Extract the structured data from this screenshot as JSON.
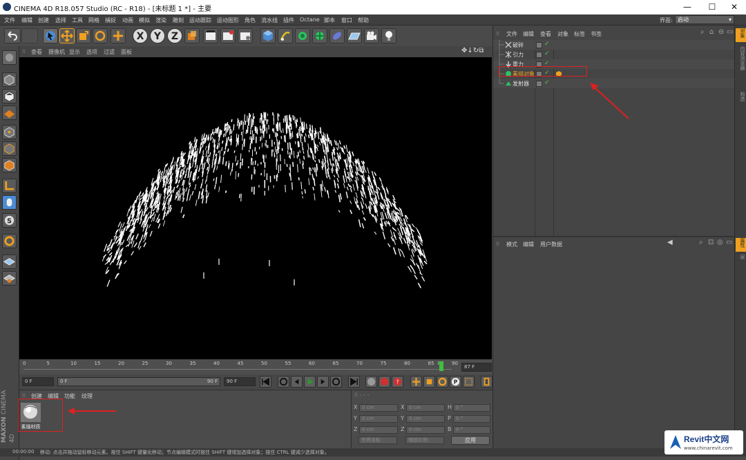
{
  "window": {
    "title": "CINEMA 4D R18.057 Studio (RC - R18) - [未标题 1 *] - 主要",
    "controls": [
      "—",
      "☐",
      "✕"
    ]
  },
  "menubar": {
    "items": [
      "文件",
      "编辑",
      "创建",
      "选择",
      "工具",
      "网格",
      "捕捉",
      "动画",
      "模拟",
      "渲染",
      "雕刻",
      "运动跟踪",
      "运动图形",
      "角色",
      "流水线",
      "插件",
      "Octane",
      "脚本",
      "窗口",
      "帮助"
    ],
    "layout_label": "界面:",
    "layout_value": "启动"
  },
  "toolbar": {
    "icons": [
      "undo-icon",
      "redo-icon",
      "select-icon",
      "move-icon",
      "scale-icon",
      "rotate-icon",
      "live-select-icon",
      "x-axis-icon",
      "y-axis-icon",
      "z-axis-icon",
      "coord-system-icon",
      "render-view-icon",
      "render-pv-icon",
      "render-settings-icon",
      "cube-icon",
      "pen-icon",
      "subdivision-icon",
      "cloner-icon",
      "deformer-icon",
      "floor-icon",
      "camera-icon",
      "light-icon"
    ],
    "axes": [
      "X",
      "Y",
      "Z"
    ]
  },
  "viewport": {
    "menu": [
      "查看",
      "摄像机",
      "显示",
      "选项",
      "过滤",
      "面板"
    ],
    "background": "#000000",
    "particle_color": "#ffffff"
  },
  "timeline": {
    "ticks": [
      "0",
      "5",
      "10",
      "15",
      "20",
      "25",
      "30",
      "35",
      "40",
      "45",
      "50",
      "55",
      "60",
      "65",
      "70",
      "75",
      "80",
      "85",
      "87",
      "90"
    ],
    "current_frame": "87 F",
    "playhead_color": "#3fbf3f"
  },
  "playbar": {
    "start_field": "0 F",
    "range_start": "0 F",
    "range_end": "90 F",
    "end_field": "90 F"
  },
  "material_panel": {
    "menu": [
      "创建",
      "编辑",
      "功能",
      "纹理"
    ],
    "material_name": "素描材质"
  },
  "coord_panel": {
    "rows": [
      {
        "l1": "X",
        "v1": "0 cm",
        "l2": "X",
        "v2": "0 cm",
        "l3": "H",
        "v3": "0 °"
      },
      {
        "l1": "Y",
        "v1": "0 cm",
        "l2": "Y",
        "v2": "0 cm",
        "l3": "P",
        "v3": "0 °"
      },
      {
        "l1": "Z",
        "v1": "0 cm",
        "l2": "Z",
        "v2": "0 cm",
        "l3": "B",
        "v3": "0 °"
      }
    ],
    "mode1": "世界坐标",
    "mode2": "缩放比例",
    "apply": "应用"
  },
  "object_manager": {
    "menu": [
      "文件",
      "编辑",
      "查看",
      "对象",
      "标签",
      "书签"
    ],
    "objects": [
      {
        "name": "破碎",
        "icon": "shatter-icon"
      },
      {
        "name": "引力",
        "icon": "attractor-icon"
      },
      {
        "name": "重力",
        "icon": "gravity-icon"
      },
      {
        "name": "素描对象",
        "icon": "sketch-object-icon"
      },
      {
        "name": "发射器",
        "icon": "emitter-icon"
      }
    ]
  },
  "attribute_manager": {
    "menu": [
      "模式",
      "编辑",
      "用户数据"
    ]
  },
  "right_strip": {
    "tabs": [
      "对象",
      "内容浏览器",
      "构造",
      "属性",
      "层"
    ]
  },
  "statusbar": {
    "time": "00:00:00",
    "message": "移动: 点击并拖动鼠标移动元素。按住 SHIFT 键量化移动；节点编辑模式时按住 SHIFT 键增加选择对象；按住 CTRL 键减少选择对象。"
  },
  "side_label": {
    "brand": "MAXON",
    "product": "CINEMA 4D"
  },
  "watermark": {
    "brand": "Revit中文网",
    "url": "www.chinarevit.com"
  },
  "accent_colors": {
    "highlight_red": "#e02020",
    "active_blue": "#4b8bd6",
    "orange": "#f0a020"
  }
}
